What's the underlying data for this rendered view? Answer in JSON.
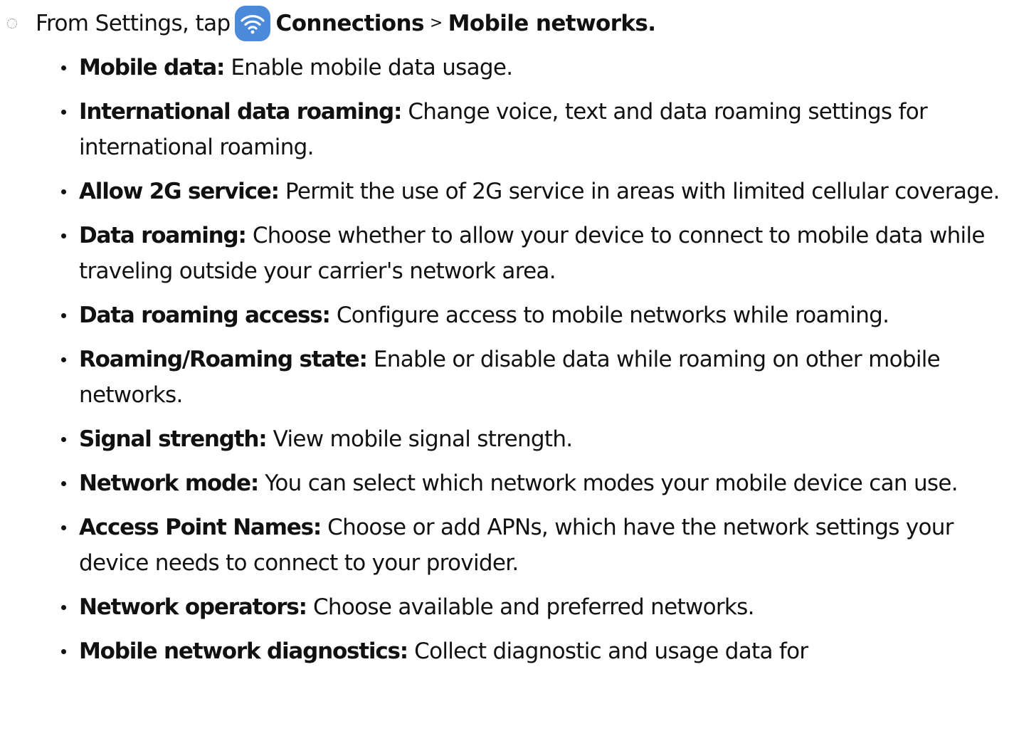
{
  "step": {
    "prefix": "From Settings, tap",
    "icon": "wifi-icon",
    "icon_color": "#4a8ad9",
    "connections_label": "Connections",
    "separator": ">",
    "mobile_networks_label": "Mobile networks",
    "end": "."
  },
  "items": [
    {
      "term": "Mobile data:",
      "desc": " Enable mobile data usage."
    },
    {
      "term": "International data roaming:",
      "desc": " Change voice, text and data roaming settings for international roaming."
    },
    {
      "term": "Allow 2G service:",
      "desc": " Permit the use of 2G service in areas with limited cellular coverage."
    },
    {
      "term": "Data roaming:",
      "desc": " Choose whether to allow your device to connect to mobile data while traveling outside your carrier's network area."
    },
    {
      "term": "Data roaming access:",
      "desc": " Configure access to mobile networks while roaming."
    },
    {
      "term": "Roaming/Roaming state:",
      "desc": " Enable or disable data while roaming on other mobile networks."
    },
    {
      "term": "Signal strength:",
      "desc": " View mobile signal strength."
    },
    {
      "term": "Network mode:",
      "desc": " You can select which network modes your mobile device can use."
    },
    {
      "term": "Access Point Names:",
      "desc": " Choose or add APNs, which have the network settings your device needs to connect to your provider."
    },
    {
      "term": "Network operators:",
      "desc": " Choose available and preferred networks."
    },
    {
      "term": "Mobile network diagnostics:",
      "desc": " Collect diagnostic and usage data for"
    }
  ]
}
